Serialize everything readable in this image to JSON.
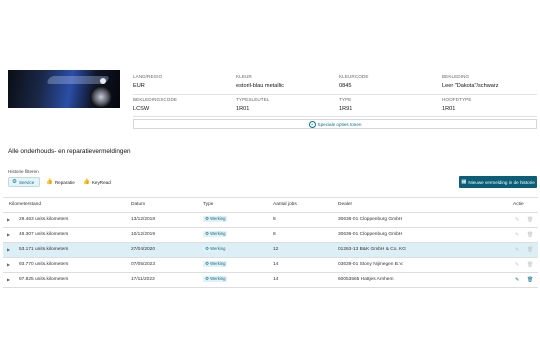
{
  "specs": [
    {
      "label": "LAND/REGIO",
      "value": "EUR"
    },
    {
      "label": "KLEUR",
      "value": "estoril-blau metallic"
    },
    {
      "label": "KLEURCODE",
      "value": "0845"
    },
    {
      "label": "BEKLEDING",
      "value": "Leer \"Dakota\"/schwarz"
    },
    {
      "label": "BEKLEDINGSCODE",
      "value": "LCSW"
    },
    {
      "label": "TYPESLEUTEL",
      "value": "1R01"
    },
    {
      "label": "TYPE",
      "value": "1R91"
    },
    {
      "label": "HOOFDTYPE",
      "value": "1R01"
    }
  ],
  "special_options_label": "Speciale opties tonen",
  "section_title": "Alle onderhouds- en reparatievermeldingen",
  "filter_label": "Historie filteren",
  "filters": [
    {
      "label": "Service",
      "icon": "service-icon"
    },
    {
      "label": "Reparatie",
      "icon": "thumbs-up-icon"
    },
    {
      "label": "KeyRead",
      "icon": "thumbs-up-icon"
    }
  ],
  "new_entry_label": "Nieuwe vermelding in de historie",
  "table": {
    "headers": [
      "Kilometerstand",
      "Datum",
      "Type",
      "Aantal jobs",
      "Dealer",
      "Actie"
    ],
    "rows": [
      {
        "km": "29.463 units.kilometers",
        "date": "13/12/2018",
        "type": "Werking",
        "jobs": "8",
        "dealer": "30636-01 Cloppenburg GmbH"
      },
      {
        "km": "48.307 units.kilometers",
        "date": "10/12/2019",
        "type": "Werking",
        "jobs": "8",
        "dealer": "30636-01 Cloppenburg GmbH"
      },
      {
        "km": "53.171 units.kilometers",
        "date": "27/04/2020",
        "type": "Werking",
        "jobs": "12",
        "dealer": "01263-13 B&K GmbH & Co. KG"
      },
      {
        "km": "93.770 units.kilometers",
        "date": "07/05/2023",
        "type": "Werking",
        "jobs": "14",
        "dealer": "03639-01 Stony Nijmegen B.V."
      },
      {
        "km": "97.825 units.kilometers",
        "date": "17/11/2023",
        "type": "Werking",
        "jobs": "14",
        "dealer": "60053565 Hattjes Arnhem"
      }
    ]
  },
  "colors": {
    "accent": "#0a5e78",
    "highlight_row": "#dceef6"
  }
}
